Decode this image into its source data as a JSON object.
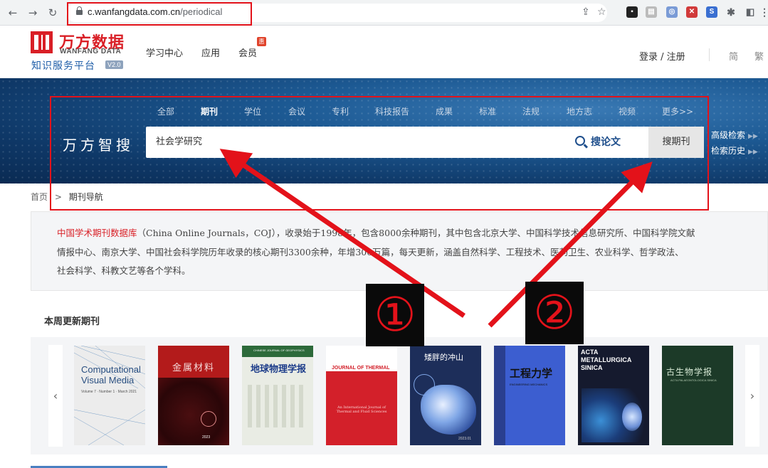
{
  "browser": {
    "url_host": "c.wanfangdata.com.cn",
    "url_path": "/periodical",
    "icons": [
      "back-icon",
      "forward-icon",
      "reload-icon",
      "share-icon",
      "bookmark-star-icon",
      "extension-icons",
      "puzzle-icon",
      "sidebar-icon",
      "menu-icon"
    ],
    "ext_labels": [
      "S"
    ]
  },
  "header": {
    "logo_cn": "万方数据",
    "logo_en": "WANFANG DATA",
    "platform": "知识服务平台",
    "version": "V2.0",
    "nav": [
      "学习中心",
      "应用",
      "会员"
    ],
    "vip_badge": "惠",
    "login": "登录 / 注册",
    "lang_simplified": "简",
    "lang_traditional": "繁"
  },
  "search": {
    "tabs": [
      "全部",
      "期刊",
      "学位",
      "会议",
      "专利",
      "科技报告",
      "成果",
      "标准",
      "法规",
      "地方志",
      "视频",
      "更多>>"
    ],
    "active_tab": "期刊",
    "brand": "万方智搜",
    "query": "社会学研究",
    "search_thesis_label": "搜论文",
    "search_journal_label": "搜期刊",
    "advanced_label": "高级检索",
    "history_label": "检索历史"
  },
  "breadcrumb": {
    "home": "首页",
    "separator": ">",
    "current": "期刊导航"
  },
  "intro": {
    "highlight": "中国学术期刊数据库",
    "line1": "（China Online Journals，COJ），收录始于1998年，包含8000余种期刊，其中包含北京大学、中国科学技术信息研究所、中国科学院文献",
    "line2": "情报中心、南京大学、中国社会科学院历年收录的核心期刊3300余种，年增300万篇，每天更新，涵盖自然科学、工程技术、医药卫生、农业科学、哲学政法、",
    "line3": "社会科学、科教文艺等各个学科。"
  },
  "weekly": {
    "title": "本周更新期刊",
    "prev": "‹",
    "next": "›",
    "covers": [
      {
        "title": "Computational Visual Media",
        "sub": "Volume 7 · Number 1 · March 2021",
        "bg": "#ececec"
      },
      {
        "title": "金属材料",
        "sub": "2023",
        "bg": "#b31b1b"
      },
      {
        "title": "地球物理学报",
        "sub": "CHINESE JOURNAL OF GEOPHYSICS",
        "bg": "#e9ece4"
      },
      {
        "title": "JOURNAL OF THERMAL SCIENCE",
        "sub": "An International Journal of Thermal and Fluid Sciences",
        "bg": "#d3202a"
      },
      {
        "title": "矮胖的冲山",
        "sub": "2023.01",
        "bg": "#1d2e5a"
      },
      {
        "title": "工程力学",
        "sub": "ENGINEERING MECHANICS",
        "bg": "#3c5ed0"
      },
      {
        "title": "ACTA METALLURGICA SINICA",
        "sub": "",
        "bg": "#151a2e"
      },
      {
        "title": "古生物学报",
        "sub": "ACTA PALAEONTOLOGICA SINICA",
        "bg": "#1c3a28"
      }
    ]
  },
  "annotations": {
    "badge1": "①",
    "badge2": "②",
    "color": "#e3121a"
  }
}
